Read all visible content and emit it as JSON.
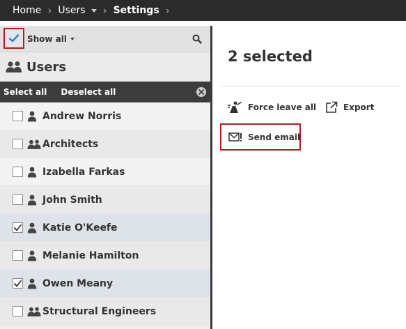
{
  "breadcrumb": {
    "home": "Home",
    "users": "Users",
    "settings": "Settings"
  },
  "filter": {
    "show_all": "Show all"
  },
  "panel": {
    "title": "Users"
  },
  "selection_bar": {
    "select_all": "Select all",
    "deselect_all": "Deselect all"
  },
  "users": [
    {
      "name": "Andrew Norris",
      "type": "user",
      "checked": false
    },
    {
      "name": "Architects",
      "type": "group",
      "checked": false
    },
    {
      "name": "Izabella Farkas",
      "type": "user",
      "checked": false
    },
    {
      "name": "John Smith",
      "type": "user",
      "checked": false
    },
    {
      "name": "Katie O'Keefe",
      "type": "user",
      "checked": true
    },
    {
      "name": "Melanie Hamilton",
      "type": "user",
      "checked": false
    },
    {
      "name": "Owen Meany",
      "type": "user",
      "checked": true
    },
    {
      "name": "Structural Engineers",
      "type": "group",
      "checked": false
    }
  ],
  "details": {
    "selected_count_text": "2 selected",
    "actions": {
      "force_leave_all": "Force leave all",
      "export": "Export",
      "send_email": "Send email"
    }
  },
  "colors": {
    "topbar": "#2b2b2b",
    "highlight": "#b51d1d",
    "checkmark_accent": "#3d7ab8"
  },
  "icons": {
    "user": "user-icon",
    "group": "group-icon",
    "search": "search-icon",
    "force_leave": "force-leave-icon",
    "export": "export-icon",
    "email": "send-email-icon"
  }
}
